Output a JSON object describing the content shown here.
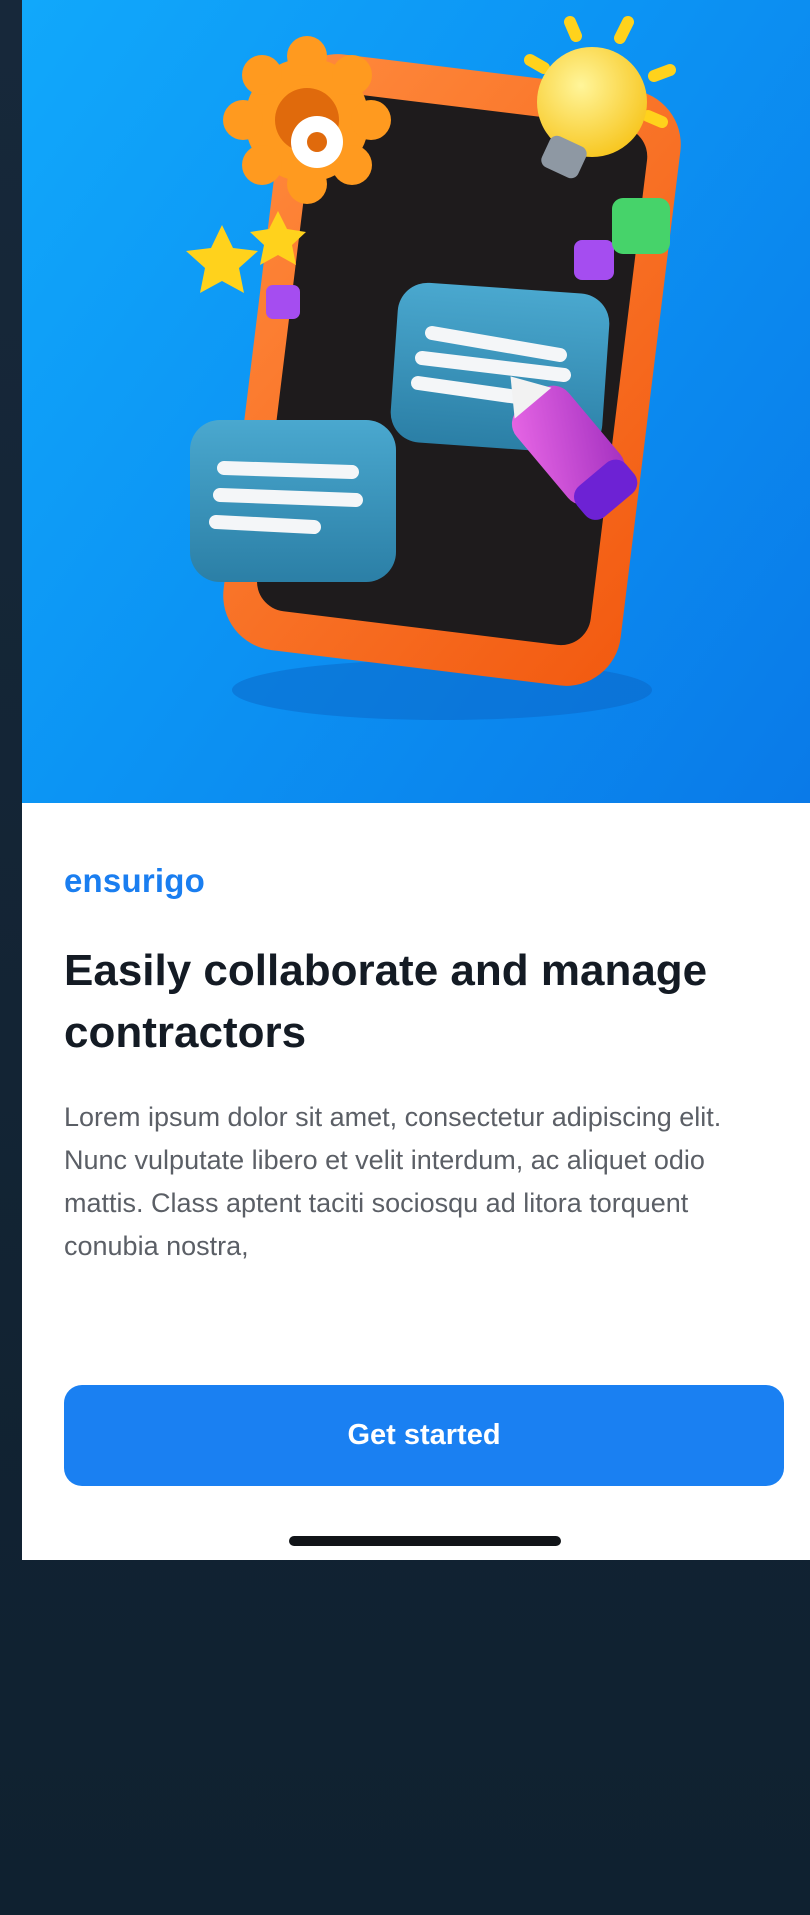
{
  "hero": {
    "illustration": "tablet-with-chat-bubbles-illustration",
    "icons": [
      "gear-icon",
      "lightbulb-icon",
      "star-icon",
      "chat-bubble-icon",
      "marker-icon"
    ]
  },
  "brand": {
    "name": "ensurigo"
  },
  "headline": {
    "text": "Easily collaborate and manage contractors"
  },
  "description": {
    "text": "Lorem ipsum dolor sit amet, consectetur adipiscing elit. Nunc vulputate libero et velit interdum, ac aliquet odio mattis. Class aptent taciti sociosqu ad litora torquent  conubia nostra,"
  },
  "cta": {
    "label": "Get started"
  },
  "colors": {
    "accent": "#1a80f2",
    "hero_gradient_start": "#11a8fb",
    "hero_gradient_end": "#0a7ae8",
    "background": "#132434"
  }
}
